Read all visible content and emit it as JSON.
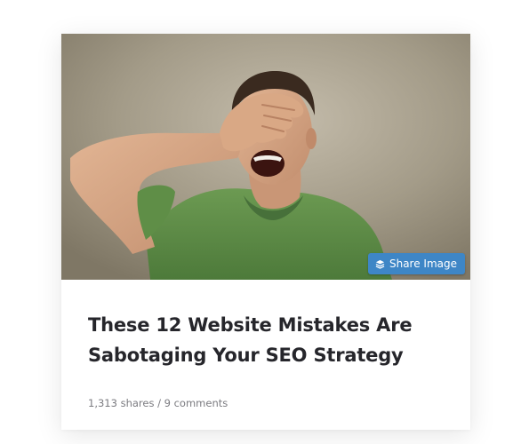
{
  "card": {
    "image": {
      "alt_subject": "man-facepalm-photo",
      "share_button_label": "Share Image",
      "share_icon": "layers-icon"
    },
    "title": "These 12 Website Mistakes Are Sabotaging Your SEO Strategy",
    "meta": {
      "shares": "1,313 shares",
      "separator": " / ",
      "comments": "9 comments"
    }
  },
  "colors": {
    "share_button_bg": "#3e86c6",
    "title_text": "#26262b",
    "meta_text": "#7b7b80",
    "shirt_green": "#5d8a45"
  }
}
